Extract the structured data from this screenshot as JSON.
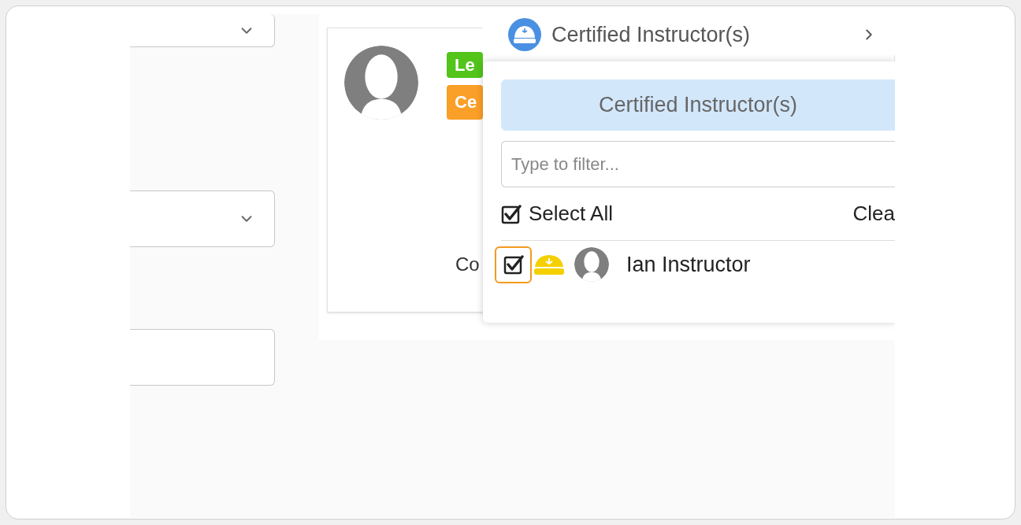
{
  "fields": [
    {
      "kind": "select"
    },
    {
      "kind": "select"
    },
    {
      "kind": "text"
    }
  ],
  "card": {
    "badges": [
      {
        "text": "Le",
        "color": "#52c41a"
      },
      {
        "text": "Ce",
        "color": "#fa9f27"
      }
    ],
    "caption": "Co"
  },
  "dropdown": {
    "label": "Certified Instructor(s)",
    "panel_title": "Certified Instructor(s)",
    "filter": {
      "placeholder": "Type to filter..."
    },
    "select_all": {
      "label": "Select All",
      "checked": true
    },
    "clear": "Clea",
    "items": [
      {
        "name": "Ian Instructor",
        "checked": true,
        "highlighted": true
      }
    ]
  }
}
